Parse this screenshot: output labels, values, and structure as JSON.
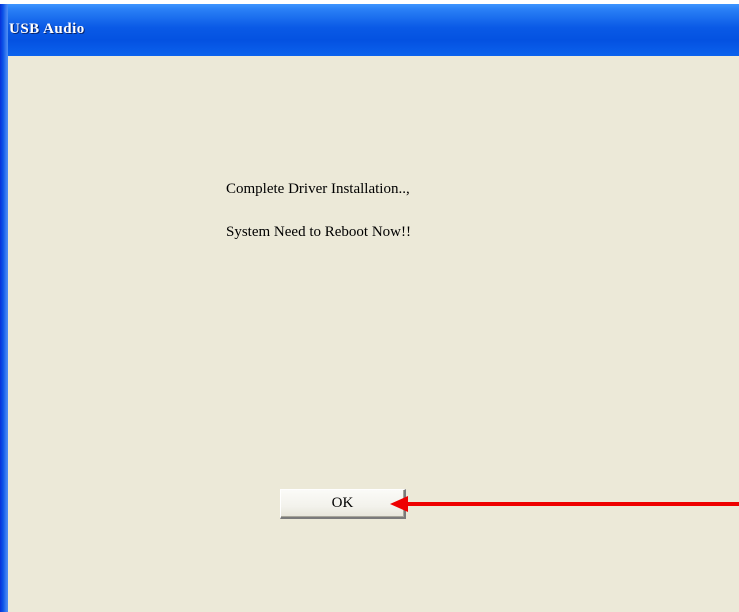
{
  "window": {
    "title": "USB Audio"
  },
  "dialog": {
    "message_line1": "Complete Driver Installation..,",
    "message_line2": "System Need to Reboot Now!!",
    "ok_label": "OK"
  },
  "colors": {
    "titlebar": "#0a5ae6",
    "dialog_background": "#ece9d8",
    "arrow": "#ee0000"
  },
  "annotation": {
    "arrow_icon": "red-arrow-left-icon"
  }
}
